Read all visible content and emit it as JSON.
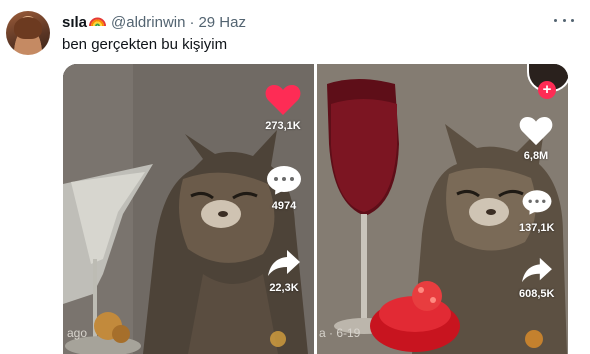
{
  "tweet": {
    "author_name": "sıla",
    "handle": "@aldrinwin",
    "separator": "·",
    "date": "29 Haz",
    "text": "ben gerçekten bu kişiyim",
    "icons": [
      "rainbow-icon",
      "more-icon"
    ]
  },
  "media": {
    "left_video": {
      "likes": "273,1K",
      "comments": "4974",
      "shares": "22,3K",
      "watermark": "ago",
      "colors": {
        "heart": "#fe2c55"
      }
    },
    "right_video": {
      "likes": "6,8M",
      "comments": "137,1K",
      "shares": "608,5K",
      "watermark": "a · 6-19",
      "colors": {
        "heart": "#ffffff",
        "follow": "#fe2c55"
      }
    }
  }
}
